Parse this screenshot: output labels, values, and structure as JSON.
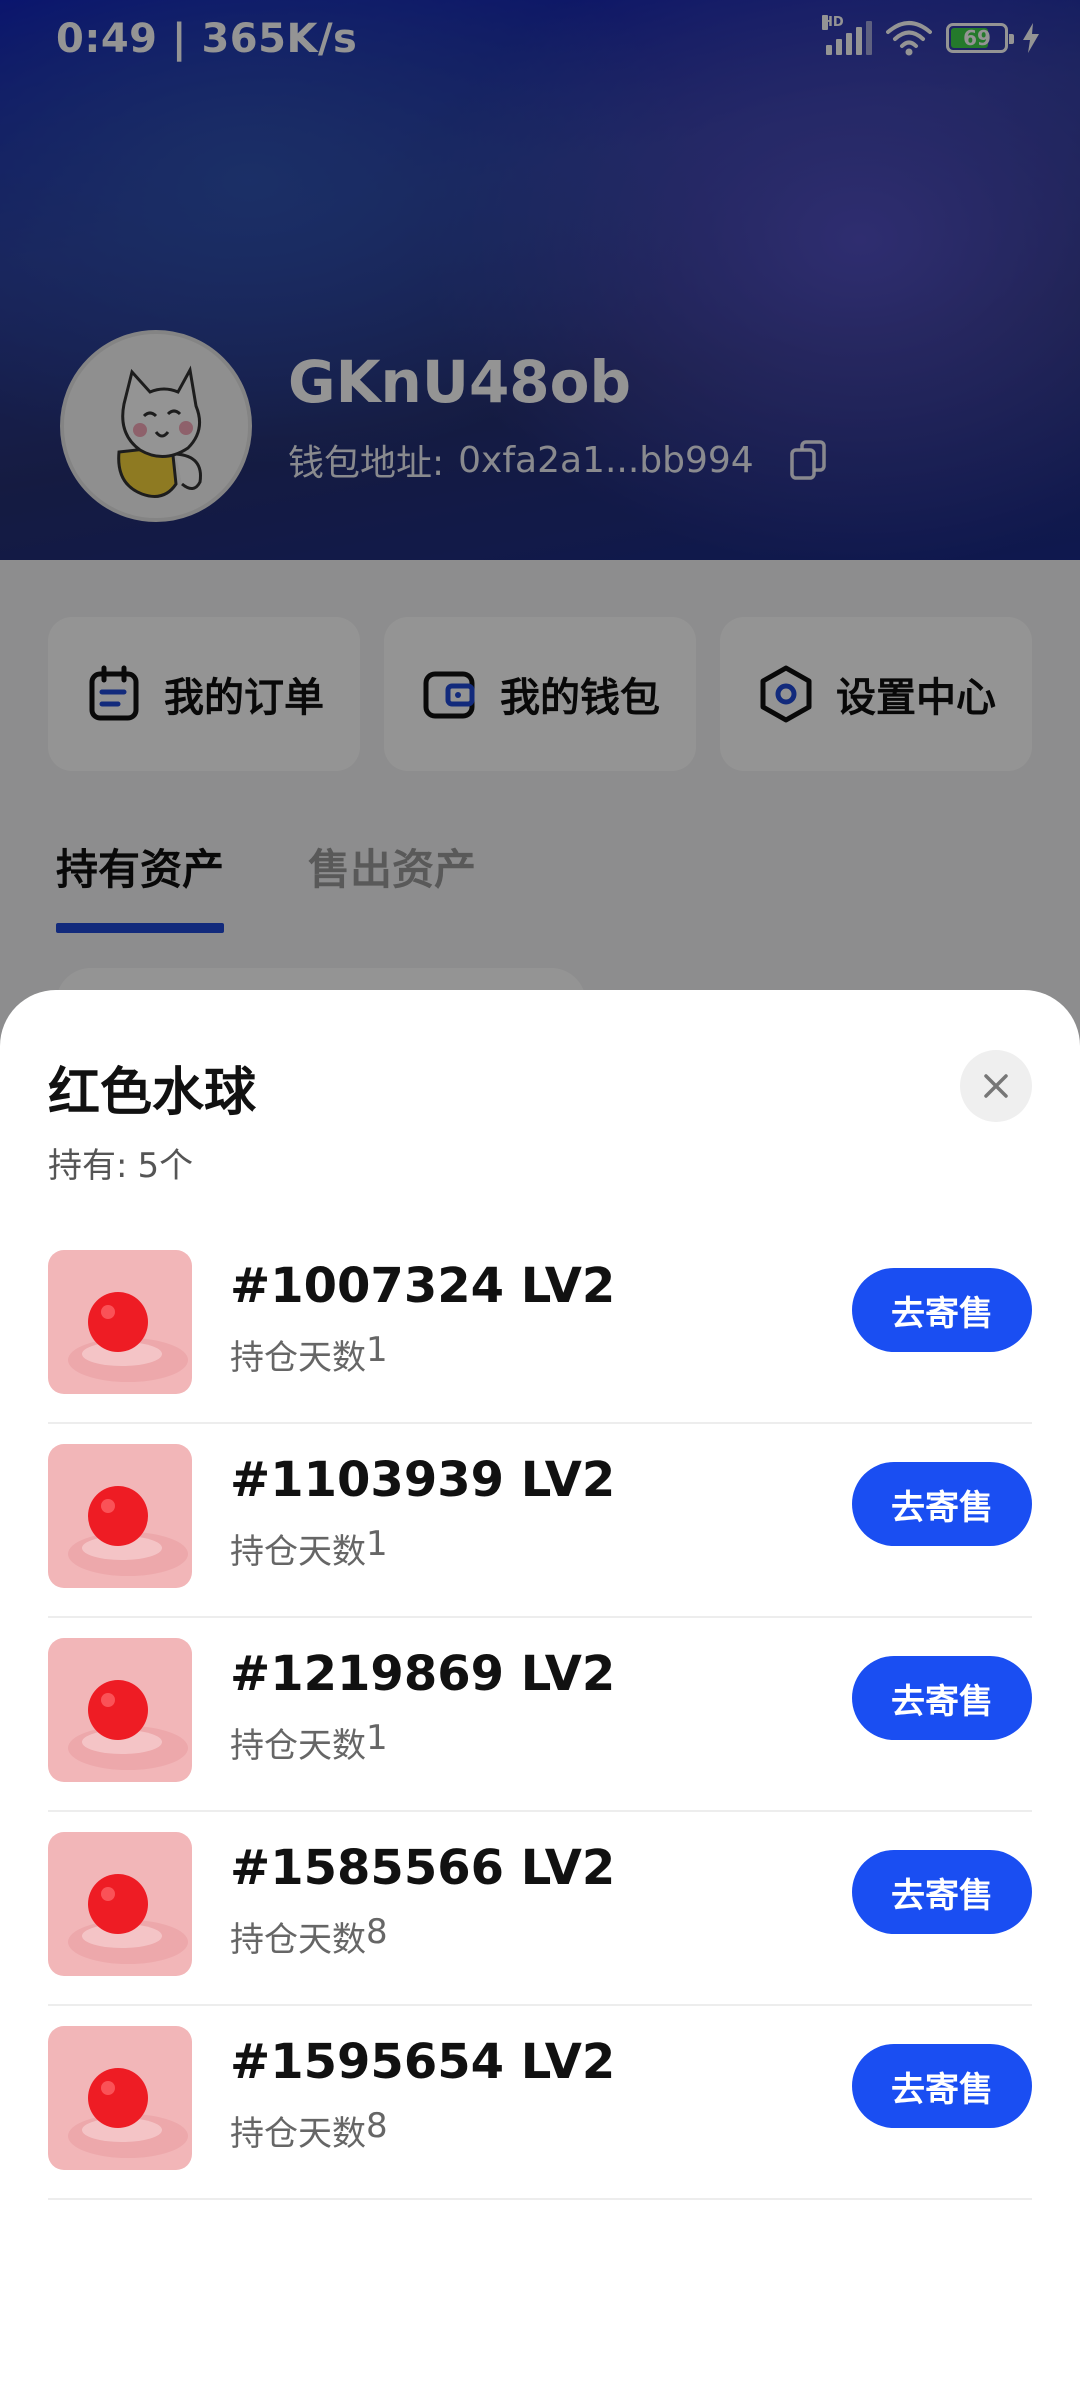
{
  "status_bar": {
    "time_speed": "0:49 | 365K/s",
    "network_label": "HD",
    "battery": "69"
  },
  "profile": {
    "username": "GKnU48ob",
    "wallet_label": "钱包地址:",
    "wallet_address": "0xfa2a1...bb994"
  },
  "menu": [
    {
      "label": "我的订单",
      "icon": "order-icon"
    },
    {
      "label": "我的钱包",
      "icon": "wallet-icon"
    },
    {
      "label": "设置中心",
      "icon": "settings-icon"
    }
  ],
  "tabs": [
    {
      "label": "持有资产",
      "active": true
    },
    {
      "label": "售出资产",
      "active": false
    }
  ],
  "sheet": {
    "title": "红色水球",
    "holding_label": "持有:",
    "holding_count": "5个",
    "items": [
      {
        "title": "#1007324 LV2",
        "days_label": "持仓天数",
        "days": "1",
        "button": "去寄售"
      },
      {
        "title": "#1103939 LV2",
        "days_label": "持仓天数",
        "days": "1",
        "button": "去寄售"
      },
      {
        "title": "#1219869 LV2",
        "days_label": "持仓天数",
        "days": "1",
        "button": "去寄售"
      },
      {
        "title": "#1585566 LV2",
        "days_label": "持仓天数",
        "days": "8",
        "button": "去寄售"
      },
      {
        "title": "#1595654 LV2",
        "days_label": "持仓天数",
        "days": "8",
        "button": "去寄售"
      }
    ]
  },
  "colors": {
    "accent": "#1a4ef2",
    "tab_underline": "#1f49d6",
    "header_blue": "#0c1cbf"
  }
}
